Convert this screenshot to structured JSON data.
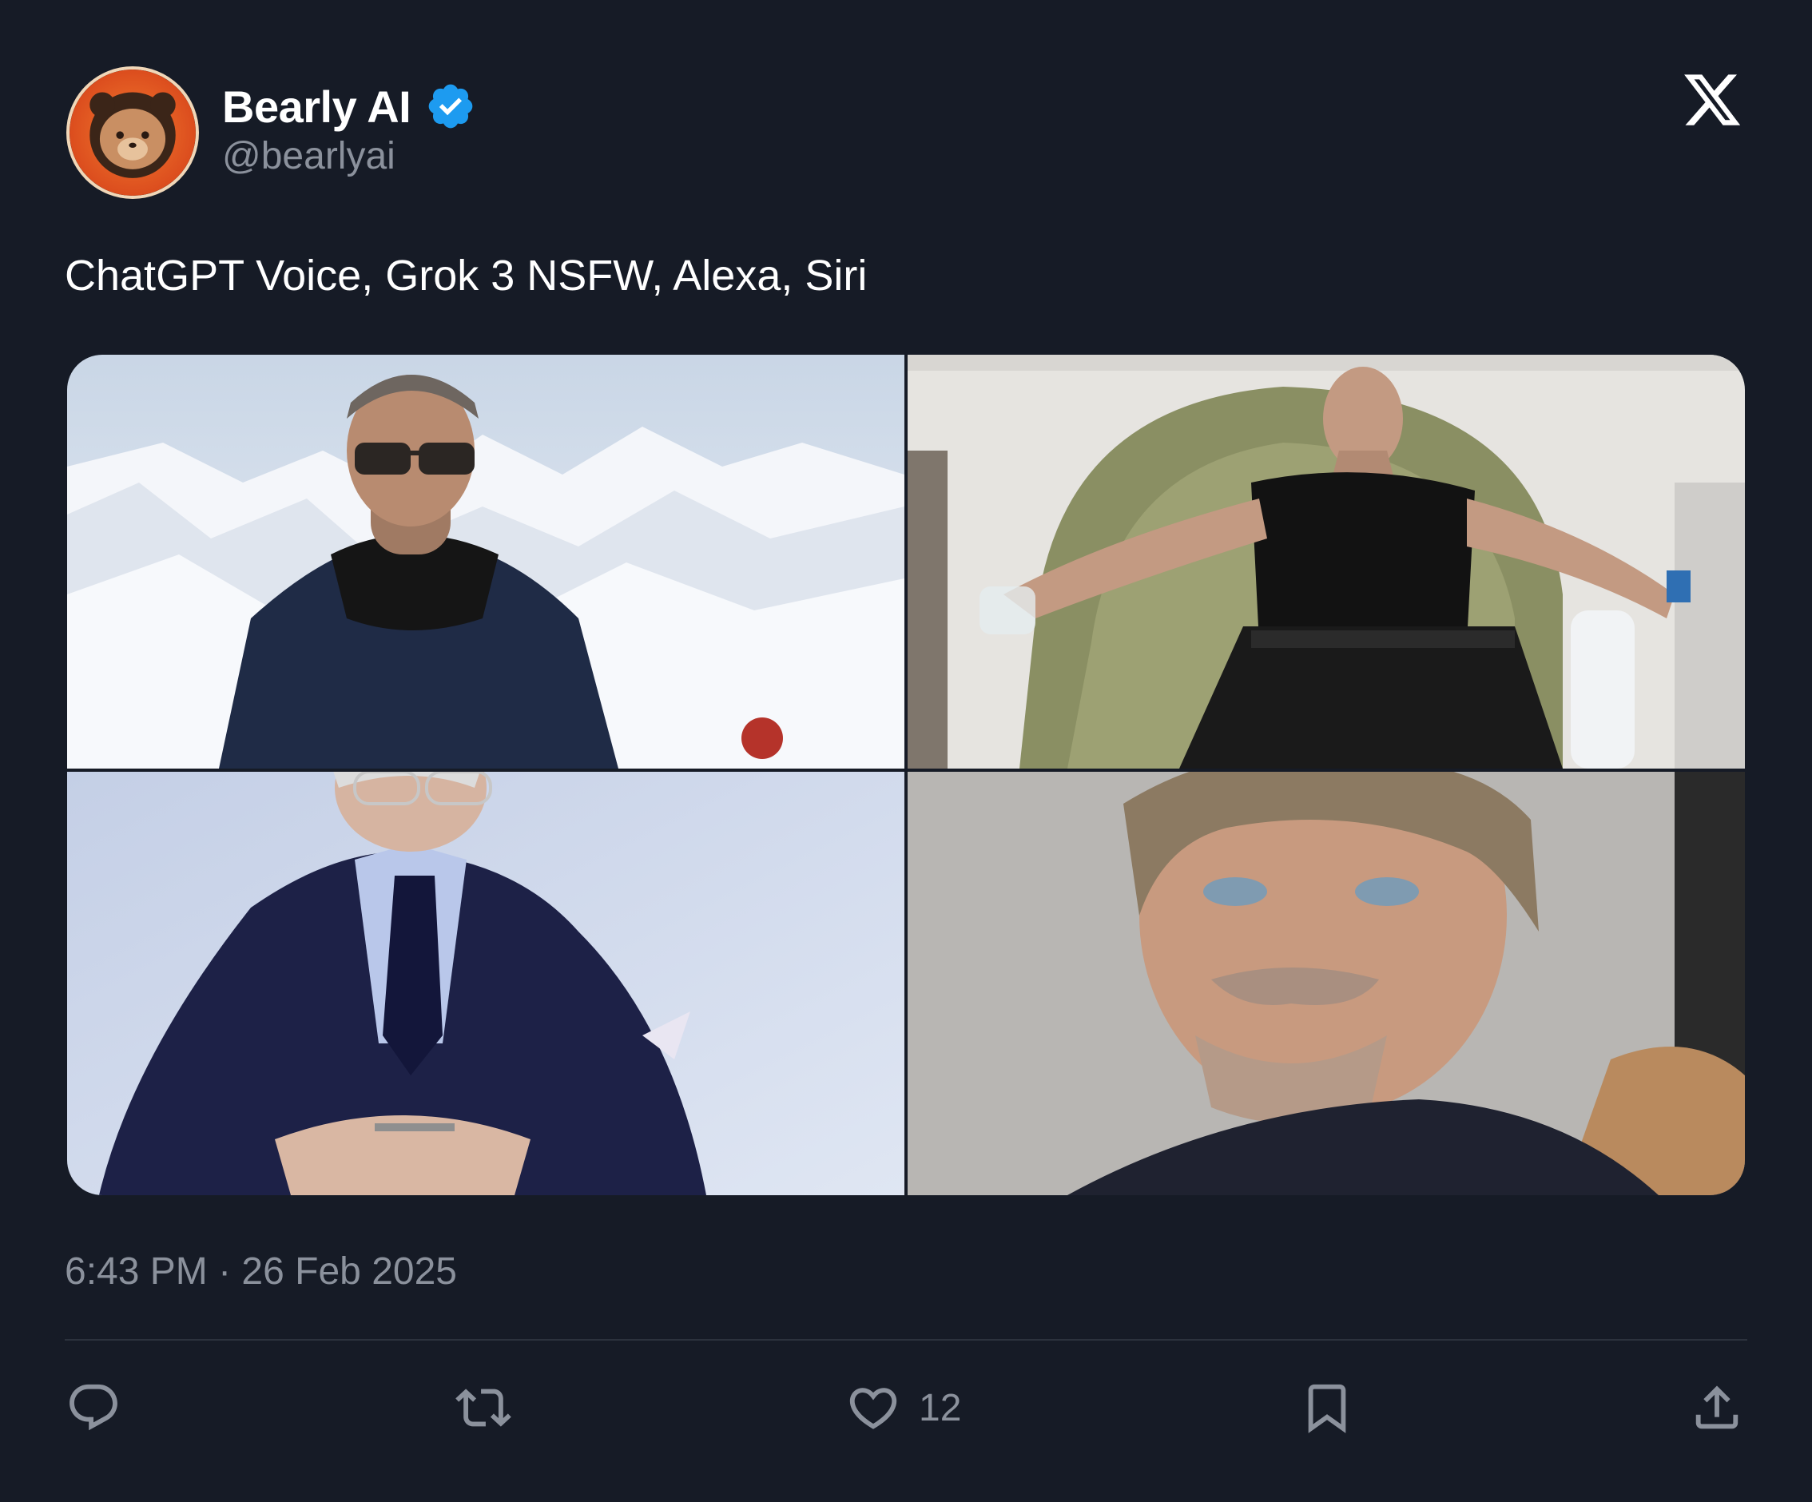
{
  "author": {
    "display_name": "Bearly AI",
    "handle": "@bearlyai",
    "verified": true,
    "avatar_icon": "bear-avatar-icon"
  },
  "tweet": {
    "text": "ChatGPT Voice, Grok 3 NSFW, Alexa, Siri",
    "timestamp": "6:43 PM · 26 Feb 2025"
  },
  "media": [
    {
      "alt": "man-in-sunglasses-mountains"
    },
    {
      "alt": "man-in-armchair-tank-top"
    },
    {
      "alt": "man-in-navy-suit-glasses"
    },
    {
      "alt": "man-with-stubble-closeup"
    }
  ],
  "actions": {
    "reply_icon": "reply-icon",
    "repost_icon": "repost-icon",
    "like_icon": "heart-icon",
    "like_count": "12",
    "bookmark_icon": "bookmark-icon",
    "share_icon": "share-icon"
  },
  "colors": {
    "background": "#161b26",
    "verified_blue": "#1d9bf0",
    "muted_text": "#8b919c"
  }
}
